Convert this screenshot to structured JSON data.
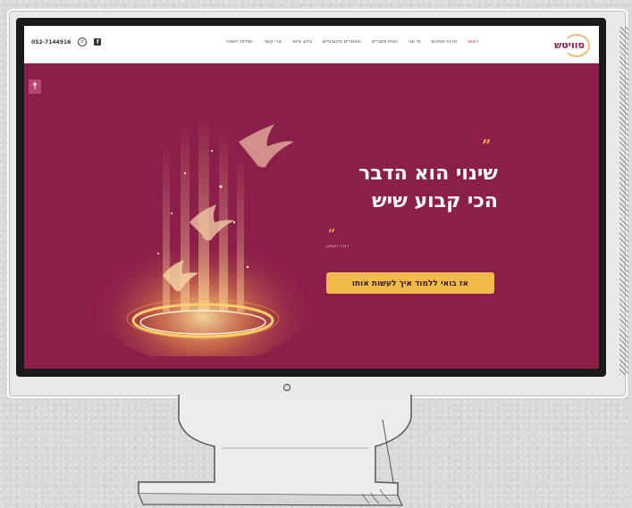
{
  "site": {
    "logo_text": "סוויטש"
  },
  "nav": {
    "items": [
      {
        "label": "ראשי",
        "active": true
      },
      {
        "label": "מרכז סוויטש",
        "active": false
      },
      {
        "label": "פי אני",
        "active": false
      },
      {
        "label": "חנות מוצרים",
        "active": false
      },
      {
        "label": "מאמרים מקצועיים",
        "active": false
      },
      {
        "label": "בלוג אישי",
        "active": false
      },
      {
        "label": "צרי קשר",
        "active": false
      },
      {
        "label": "יסודות השינוי",
        "active": false
      }
    ],
    "phone": "052-7144916"
  },
  "hero": {
    "quote_mark_open": "”",
    "headline_line1": "שינוי הוא הדבר",
    "headline_line2": "הכי קבוע שיש",
    "quote_mark_close": "”",
    "author": "דבורי וקסמן",
    "cta_label": "אז בואי ללמוד איך לעשות אותו"
  },
  "icons": {
    "accessibility": "accessibility-icon",
    "whatsapp": "whatsapp-icon",
    "facebook": "facebook-icon"
  },
  "colors": {
    "hero_background": "#8c1e4a",
    "accent_gold": "#f2ba4b",
    "nav_active": "#c4315e"
  }
}
